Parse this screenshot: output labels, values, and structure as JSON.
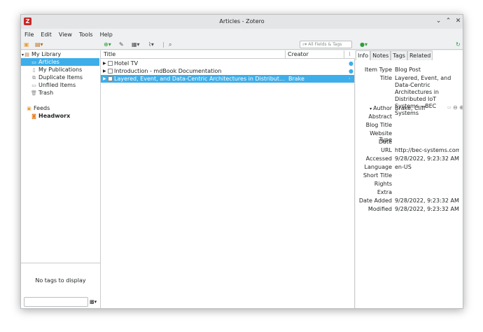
{
  "window": {
    "title": "Articles - Zotero"
  },
  "menu": [
    "File",
    "Edit",
    "View",
    "Tools",
    "Help"
  ],
  "search": {
    "placeholder": "All Fields & Tags"
  },
  "collections": {
    "library": "My Library",
    "articles": "Articles",
    "publications": "My Publications",
    "duplicates": "Duplicate Items",
    "unfiled": "Unfiled Items",
    "trash": "Trash",
    "feeds": "Feeds",
    "feed_item": "Headworx"
  },
  "tags": {
    "empty_message": "No tags to display"
  },
  "items": {
    "headers": {
      "title": "Title",
      "creator": "Creator"
    },
    "rows": [
      {
        "title": "Hotel TV",
        "creator": ""
      },
      {
        "title": "Introduction - mdBook Documentation",
        "creator": ""
      },
      {
        "title": "Layered, Event, and Data-Centric Architectures in Distributed IoT Syst...",
        "creator": "Brake"
      }
    ]
  },
  "detail": {
    "tabs": [
      "Info",
      "Notes",
      "Tags",
      "Related"
    ],
    "fields": [
      {
        "label": "Item Type",
        "value": "Blog Post"
      },
      {
        "label": "Title",
        "value": "Layered, Event, and Data-Centric Architectures in Distributed IoT Systems – BEC Systems"
      },
      {
        "label": "Author",
        "value": "Brake, Cliff"
      },
      {
        "label": "Abstract",
        "value": ""
      },
      {
        "label": "Blog Title",
        "value": ""
      },
      {
        "label": "Website Type",
        "value": ""
      },
      {
        "label": "Date",
        "value": ""
      },
      {
        "label": "URL",
        "value": "http://bec-systems.com/..."
      },
      {
        "label": "Accessed",
        "value": "9/28/2022, 9:23:32 AM"
      },
      {
        "label": "Language",
        "value": "en-US"
      },
      {
        "label": "Short Title",
        "value": ""
      },
      {
        "label": "Rights",
        "value": ""
      },
      {
        "label": "Extra",
        "value": ""
      },
      {
        "label": "Date Added",
        "value": "9/28/2022, 9:23:32 AM"
      },
      {
        "label": "Modified",
        "value": "9/28/2022, 9:23:32 AM"
      }
    ]
  },
  "colors": {
    "selection": "#3daee9",
    "app_icon": "#c62828"
  }
}
